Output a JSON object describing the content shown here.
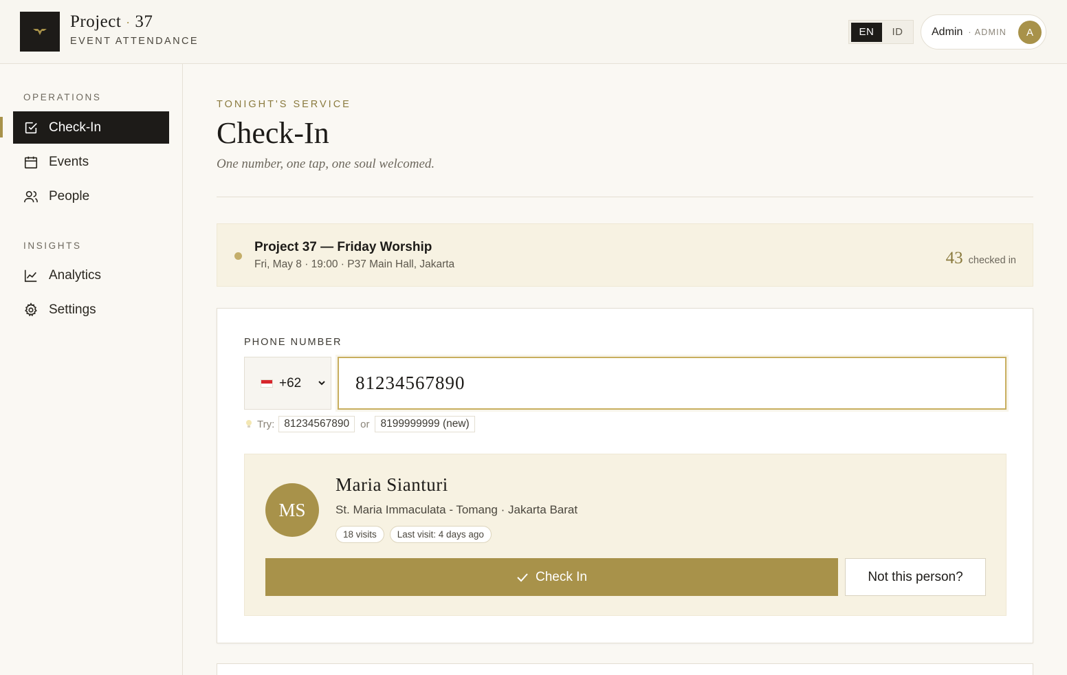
{
  "brand": {
    "title": "Project",
    "title_dot": "·",
    "title_num": "37",
    "subtitle": "EVENT ATTENDANCE"
  },
  "header": {
    "lang_active": "EN",
    "lang_inactive": "ID",
    "user_name": "Admin",
    "user_role": "· ADMIN",
    "avatar_initial": "A"
  },
  "sidebar": {
    "section_ops": "OPERATIONS",
    "section_insights": "INSIGHTS",
    "items": [
      {
        "label": "Check-In",
        "icon": "checkbox-icon",
        "active": true
      },
      {
        "label": "Events",
        "icon": "calendar-icon"
      },
      {
        "label": "People",
        "icon": "people-icon"
      },
      {
        "label": "Analytics",
        "icon": "chart-icon"
      },
      {
        "label": "Settings",
        "icon": "gear-icon"
      }
    ]
  },
  "main": {
    "eyebrow": "TONIGHT'S SERVICE",
    "title": "Check-In",
    "tagline": "One number, one tap, one soul welcomed."
  },
  "event": {
    "name": "Project 37 — Friday Worship",
    "meta": "Fri, May 8 · 19:00 · P37 Main Hall, Jakarta",
    "count": "43",
    "count_label": "checked in"
  },
  "form": {
    "label": "PHONE NUMBER",
    "country_code": "+62",
    "phone_value": "81234567890",
    "try_label": "Try:",
    "try_example_1": "81234567890",
    "try_or": "or",
    "try_example_2": "8199999999 (new)"
  },
  "person": {
    "initials": "MS",
    "name": "Maria Sianturi",
    "parish": "St. Maria Immaculata - Tomang · Jakarta Barat",
    "visits": "18 visits",
    "last_visit": "Last visit: 4 days ago",
    "checkin_label": "Check In",
    "not_person_label": "Not this person?"
  },
  "colors": {
    "accent": "#a8924a",
    "dark": "#1d1b18",
    "card_bg": "#f7f2e2"
  }
}
